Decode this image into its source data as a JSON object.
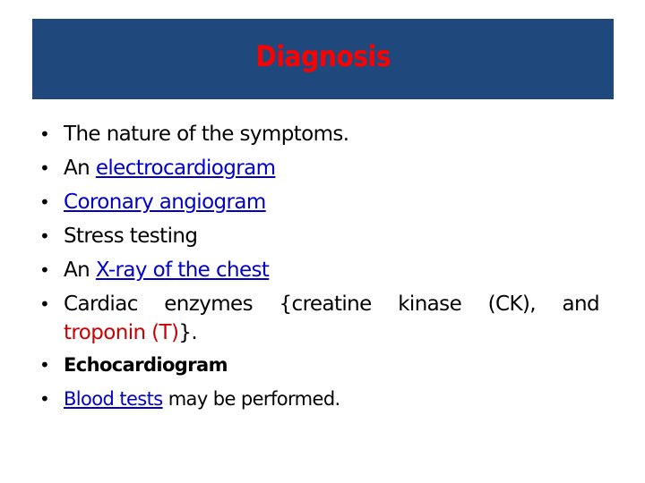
{
  "slide": {
    "title": "Diagnosis",
    "colors": {
      "header_bg": "#1f497d",
      "title_text": "#ff0000",
      "link": "#0000cc",
      "highlight": "#cc0000",
      "body_text": "#000000"
    },
    "bullets": [
      {
        "text": "The nature of the symptoms."
      },
      {
        "prefix": "An ",
        "link": "electrocardiogram"
      },
      {
        "link": "Coronary angiogram"
      },
      {
        "text": "Stress testing"
      },
      {
        "prefix": "An ",
        "link": "X-ray of the chest"
      },
      {
        "line1": "Cardiac enzymes {creatine kinase (CK), and",
        "highlight": "troponin (T)",
        "suffix": "}."
      },
      {
        "bold": "Echocardiogram"
      },
      {
        "link": "Blood tests",
        "suffix": " may be performed."
      }
    ],
    "bullet_glyph": "•"
  }
}
